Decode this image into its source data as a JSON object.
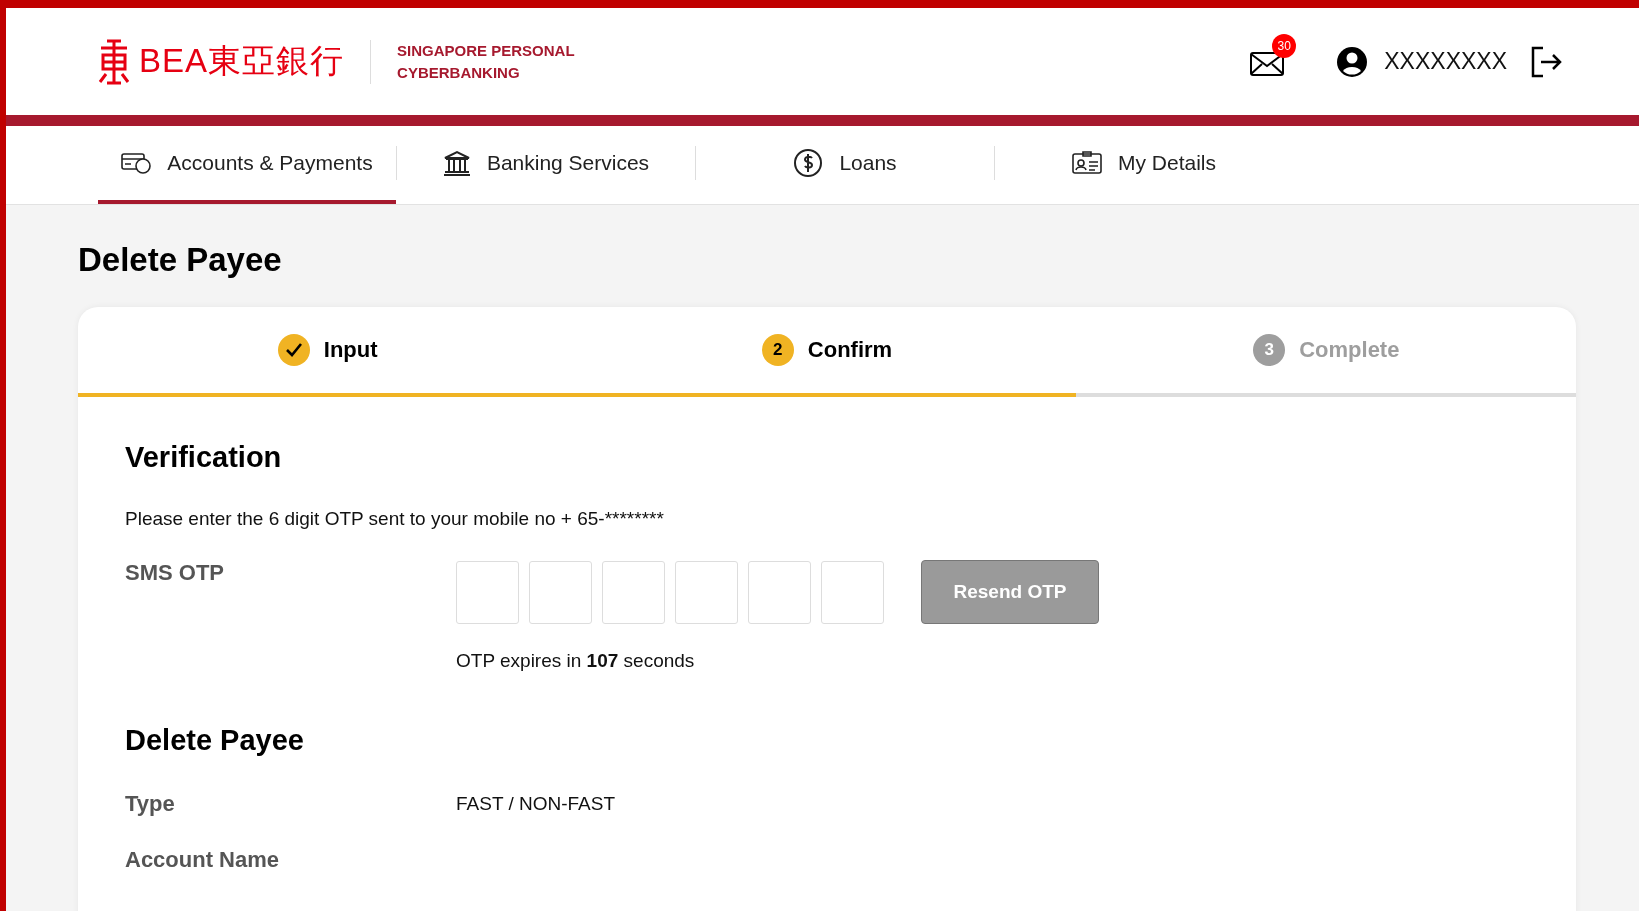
{
  "header": {
    "logo_text": "BEA東亞銀行",
    "subtitle_lines": [
      "SINGAPORE PERSONAL",
      "CYBERBANKING"
    ],
    "mail_badge": "30",
    "username": "XXXXXXXX"
  },
  "nav": {
    "tabs": [
      {
        "label": "Accounts & Payments",
        "selected": true
      },
      {
        "label": "Banking Services",
        "selected": false
      },
      {
        "label": "Loans",
        "selected": false
      },
      {
        "label": "My Details",
        "selected": false
      }
    ]
  },
  "page_title": "Delete Payee",
  "steps": {
    "level": 0.666,
    "items": [
      {
        "label": "Input",
        "completed": true,
        "active": true
      },
      {
        "number": "2",
        "label": "Confirm",
        "completed": false,
        "active": true
      },
      {
        "number": "3",
        "label": "Complete",
        "completed": false,
        "active": false
      }
    ]
  },
  "verification": {
    "heading": "Verification",
    "instruction": "Please enter the 6 digit OTP sent to your mobile no + 65-********",
    "otp_label": "SMS OTP",
    "otp_digits": [
      {
        "filled": false
      },
      {
        "filled": false
      },
      {
        "filled": false
      },
      {
        "filled": false
      },
      {
        "filled": false
      },
      {
        "filled": false
      }
    ],
    "resend_button": {
      "label": "Resend OTP",
      "disabled": true
    },
    "expiry": "OTP expires in **107** seconds"
  },
  "details": {
    "heading": "Delete Payee",
    "rows": [
      {
        "label": "Type",
        "value": "FAST / NON-FAST"
      },
      {
        "label": "Account Name"
      }
    ]
  }
}
